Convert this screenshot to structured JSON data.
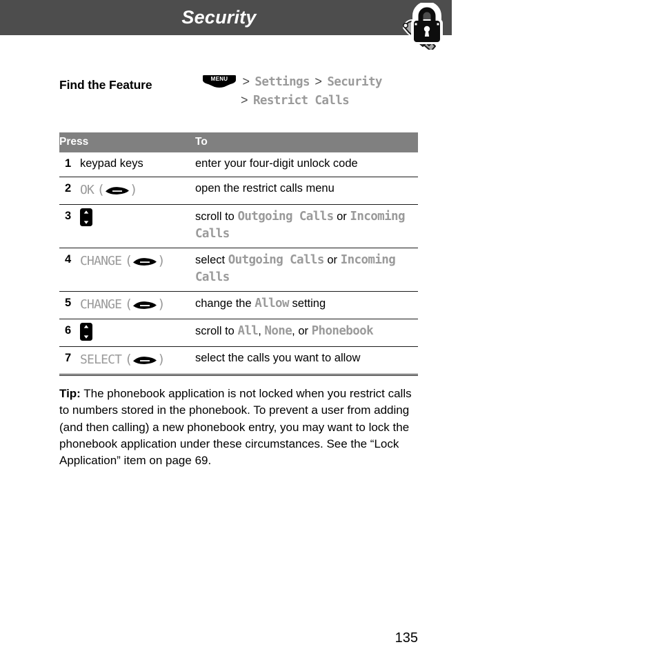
{
  "header": {
    "title": "Security",
    "icon": "padlock-and-key-icon",
    "bar_color": "#4d4d4d",
    "title_color": "#ffffff"
  },
  "find_feature": {
    "label": "Find the Feature",
    "menu_badge": "MENU",
    "separator": ">",
    "path_line1": [
      "Settings",
      "Security"
    ],
    "path_line2": [
      "Restrict Calls"
    ]
  },
  "table": {
    "header_color": "#808080",
    "columns": [
      "Press",
      "To"
    ],
    "rows": [
      {
        "num": "1",
        "press_text": "keypad keys",
        "press_icon": "",
        "press_suffix": "",
        "to_parts": [
          {
            "text": "enter your four-digit unlock code",
            "style": "body"
          }
        ]
      },
      {
        "num": "2",
        "press_text": "OK",
        "press_icon": "softkey-arrow-icon",
        "press_suffix": "",
        "to_parts": [
          {
            "text": "open the restrict calls menu",
            "style": "body"
          }
        ]
      },
      {
        "num": "3",
        "press_text": "",
        "press_icon": "nav-scroll-key-icon",
        "press_suffix": "",
        "to_parts": [
          {
            "text": "scroll to ",
            "style": "body"
          },
          {
            "text": "Outgoing Calls",
            "style": "display"
          },
          {
            "text": " or ",
            "style": "body"
          },
          {
            "text": "Incoming Calls",
            "style": "display"
          }
        ]
      },
      {
        "num": "4",
        "press_text": "CHANGE",
        "press_icon": "softkey-arrow-icon",
        "press_suffix": "",
        "to_parts": [
          {
            "text": "select ",
            "style": "body"
          },
          {
            "text": "Outgoing Calls",
            "style": "display"
          },
          {
            "text": " or ",
            "style": "body"
          },
          {
            "text": "Incoming Calls",
            "style": "display"
          }
        ]
      },
      {
        "num": "5",
        "press_text": "CHANGE",
        "press_icon": "softkey-arrow-icon",
        "press_suffix": "",
        "to_parts": [
          {
            "text": "change the ",
            "style": "body"
          },
          {
            "text": "Allow",
            "style": "display"
          },
          {
            "text": " setting",
            "style": "body"
          }
        ]
      },
      {
        "num": "6",
        "press_text": "",
        "press_icon": "nav-scroll-key-icon",
        "press_suffix": "",
        "to_parts": [
          {
            "text": "scroll to ",
            "style": "body"
          },
          {
            "text": "All",
            "style": "display"
          },
          {
            "text": ", ",
            "style": "body"
          },
          {
            "text": "None",
            "style": "display"
          },
          {
            "text": ", or ",
            "style": "body"
          },
          {
            "text": "Phonebook",
            "style": "display"
          }
        ]
      },
      {
        "num": "7",
        "press_text": "SELECT",
        "press_icon": "softkey-arrow-icon",
        "press_suffix": "",
        "to_parts": [
          {
            "text": "select the calls you want to allow",
            "style": "body"
          }
        ]
      }
    ]
  },
  "tip": {
    "label": "Tip:",
    "text": " The phonebook application is not locked when you restrict calls to numbers stored in the phonebook. To prevent a user from adding (and then calling) a new phonebook entry, you may want to lock the phonebook application under these circumstances. See the “Lock Application” item on page 69."
  },
  "page_number": "135"
}
